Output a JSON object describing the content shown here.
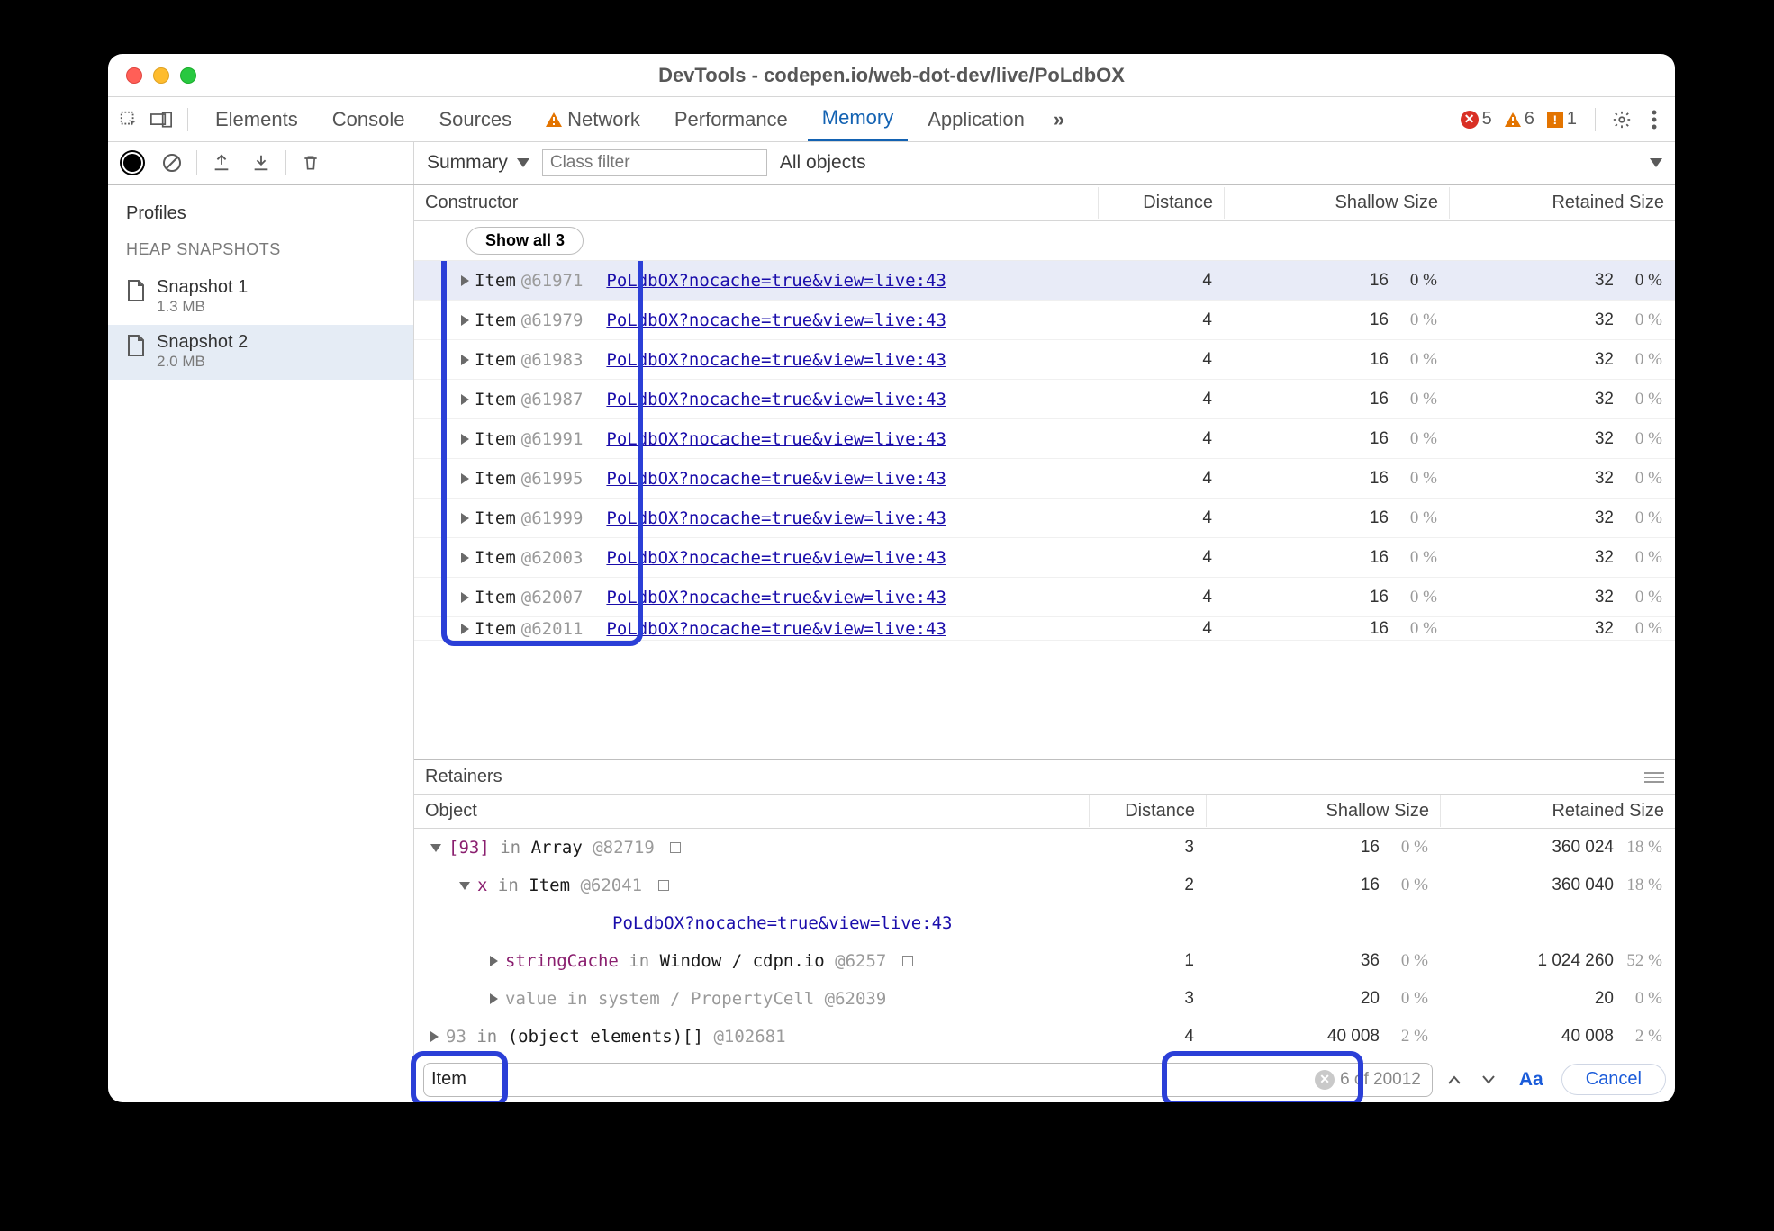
{
  "window": {
    "title": "DevTools - codepen.io/web-dot-dev/live/PoLdbOX"
  },
  "tabs": {
    "items": [
      "Elements",
      "Console",
      "Sources",
      "Network",
      "Performance",
      "Memory",
      "Application"
    ],
    "active": "Memory",
    "warn_tab": "Network",
    "more_glyph": "»",
    "errors": "5",
    "warnings": "6",
    "issues": "1"
  },
  "toolbar": {
    "view_select": "Summary",
    "class_filter_placeholder": "Class filter",
    "scope_select": "All objects"
  },
  "sidebar": {
    "profiles_title": "Profiles",
    "heap_title": "HEAP SNAPSHOTS",
    "snaps": [
      {
        "name": "Snapshot 1",
        "size": "1.3 MB"
      },
      {
        "name": "Snapshot 2",
        "size": "2.0 MB"
      }
    ]
  },
  "grid": {
    "cols": {
      "constructor": "Constructor",
      "distance": "Distance",
      "shallow": "Shallow Size",
      "retained": "Retained Size"
    },
    "show_all": "Show all 3",
    "link": "PoLdbOX?nocache=true&view=live:43",
    "rows": [
      {
        "name": "Item",
        "id": "@61971",
        "dist": "4",
        "sh": "16",
        "shp": "0 %",
        "rt": "32",
        "rtp": "0 %",
        "sel": true
      },
      {
        "name": "Item",
        "id": "@61979",
        "dist": "4",
        "sh": "16",
        "shp": "0 %",
        "rt": "32",
        "rtp": "0 %"
      },
      {
        "name": "Item",
        "id": "@61983",
        "dist": "4",
        "sh": "16",
        "shp": "0 %",
        "rt": "32",
        "rtp": "0 %"
      },
      {
        "name": "Item",
        "id": "@61987",
        "dist": "4",
        "sh": "16",
        "shp": "0 %",
        "rt": "32",
        "rtp": "0 %"
      },
      {
        "name": "Item",
        "id": "@61991",
        "dist": "4",
        "sh": "16",
        "shp": "0 %",
        "rt": "32",
        "rtp": "0 %"
      },
      {
        "name": "Item",
        "id": "@61995",
        "dist": "4",
        "sh": "16",
        "shp": "0 %",
        "rt": "32",
        "rtp": "0 %"
      },
      {
        "name": "Item",
        "id": "@61999",
        "dist": "4",
        "sh": "16",
        "shp": "0 %",
        "rt": "32",
        "rtp": "0 %"
      },
      {
        "name": "Item",
        "id": "@62003",
        "dist": "4",
        "sh": "16",
        "shp": "0 %",
        "rt": "32",
        "rtp": "0 %"
      },
      {
        "name": "Item",
        "id": "@62007",
        "dist": "4",
        "sh": "16",
        "shp": "0 %",
        "rt": "32",
        "rtp": "0 %"
      },
      {
        "name": "Item",
        "id": "@62011",
        "dist": "4",
        "sh": "16",
        "shp": "0 %",
        "rt": "32",
        "rtp": "0 %",
        "cut": true
      }
    ]
  },
  "retainers": {
    "title": "Retainers",
    "cols": {
      "object": "Object",
      "distance": "Distance",
      "shallow": "Shallow Size",
      "retained": "Retained Size"
    },
    "link": "PoLdbOX?nocache=true&view=live:43",
    "rows": [
      {
        "indent": 0,
        "open": true,
        "html": "<span class='kw-idx'>[93]</span> <span class='kw-in'>in</span> <span class='kw-type'>Array</span> <span class='kw-dim'>@82719</span> <span class='sq-after'></span>",
        "dist": "3",
        "sh": "16",
        "shp": "0 %",
        "rt": "360 024",
        "rtp": "18 %"
      },
      {
        "indent": 1,
        "open": true,
        "html": "<span class='kw-prop'>x</span> <span class='kw-in'>in</span> <span class='kw-type'>Item</span> <span class='kw-dim'>@62041</span> <span class='sq-after'></span>",
        "dist": "2",
        "sh": "16",
        "shp": "0 %",
        "rt": "360 040",
        "rtp": "18 %"
      },
      {
        "indent": 2,
        "linkonly": true
      },
      {
        "indent": 2,
        "html": "<span class='kw-prop'>stringCache</span> <span class='kw-in'>in</span> <span class='kw-type'>Window / cdpn.io</span> <span class='kw-dim'>@6257</span> <span class='sq-after'></span>",
        "dist": "1",
        "sh": "36",
        "shp": "0 %",
        "rt": "1 024 260",
        "rtp": "52 %"
      },
      {
        "indent": 2,
        "dim": true,
        "html": "<span class='kw-dim'>value</span> <span class='kw-dim'>in</span> <span class='kw-dim'>system / PropertyCell</span> <span class='kw-dim'>@62039</span>",
        "dist": "3",
        "sh": "20",
        "shp": "0 %",
        "rt": "20",
        "rtp": "0 %"
      },
      {
        "indent": 0,
        "html": "<span class='kw-dim'>93</span> <span class='kw-in'>in</span> <span class='kw-type'>(object elements)[]</span> <span class='kw-dim'>@102681</span>",
        "dist": "4",
        "sh": "40 008",
        "shp": "2 %",
        "rt": "40 008",
        "rtp": "2 %"
      }
    ]
  },
  "search": {
    "value": "Item",
    "count": "6 of 20012",
    "aa": "Aa",
    "cancel": "Cancel"
  }
}
